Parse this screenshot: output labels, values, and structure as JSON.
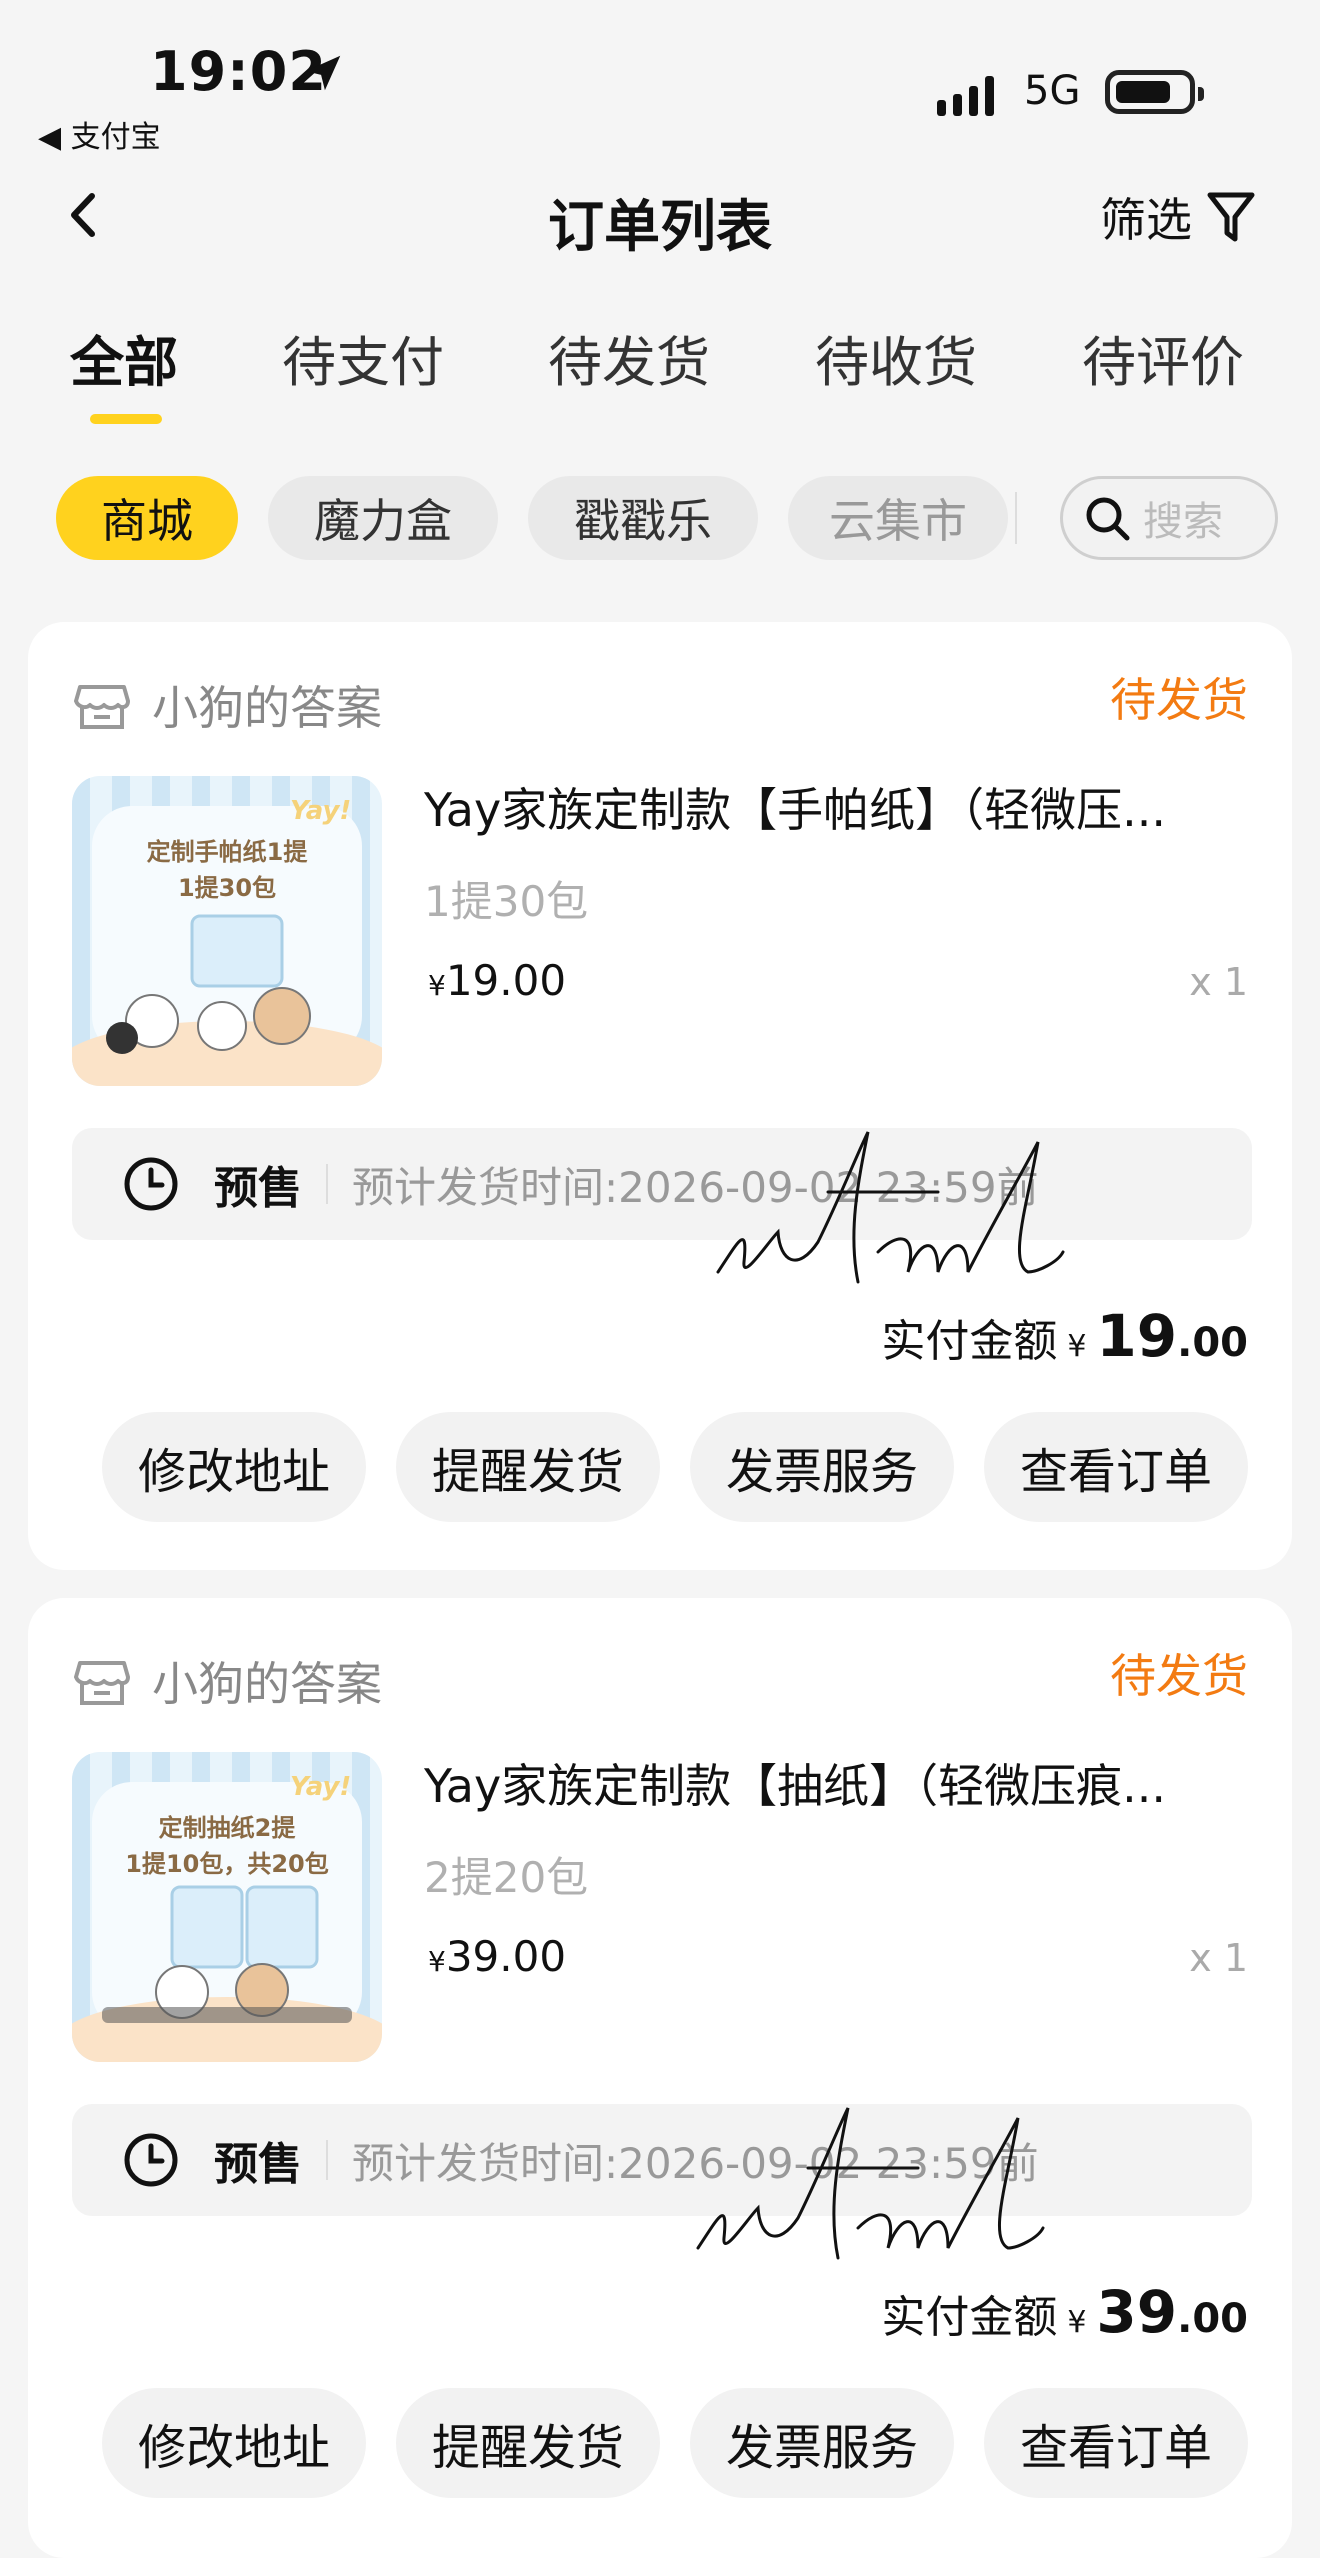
{
  "status_bar": {
    "time": "19:02",
    "back_app": "◀ 支付宝",
    "network": "5G"
  },
  "nav": {
    "title": "订单列表",
    "filter_label": "筛选"
  },
  "tabs": [
    {
      "label": "全部",
      "active": true
    },
    {
      "label": "待支付"
    },
    {
      "label": "待发货"
    },
    {
      "label": "待收货"
    },
    {
      "label": "待评价"
    }
  ],
  "chips": [
    {
      "label": "商城",
      "active": true
    },
    {
      "label": "魔力盒"
    },
    {
      "label": "戳戳乐"
    },
    {
      "label": "云集市"
    }
  ],
  "search": {
    "placeholder": "搜索"
  },
  "accent_color": "#ffd21e",
  "status_color": "#f37b12",
  "orders": [
    {
      "shop": "小狗的答案",
      "status": "待发货",
      "thumb_text": [
        "定制手帕纸1提",
        "1提30包"
      ],
      "thumb_brand": "Yay!",
      "title": "Yay家族定制款【手帕纸】（轻微压...",
      "spec": "1提30包",
      "currency": "¥",
      "price": "19.00",
      "qty": "x 1",
      "presale_label": "预售",
      "eta": "预计发货时间:2026-09-02 23:59前",
      "paid_label": "实付金额",
      "paid_int": "19",
      "paid_dec": ".00",
      "watermark": "wtml",
      "buttons": [
        "修改地址",
        "提醒发货",
        "发票服务",
        "查看订单"
      ]
    },
    {
      "shop": "小狗的答案",
      "status": "待发货",
      "thumb_text": [
        "定制抽纸2提",
        "1提10包，共20包"
      ],
      "thumb_brand": "Yay!",
      "title": "Yay家族定制款【抽纸】（轻微压痕...",
      "spec": "2提20包",
      "currency": "¥",
      "price": "39.00",
      "qty": "x 1",
      "presale_label": "预售",
      "eta": "预计发货时间:2026-09-02 23:59前",
      "paid_label": "实付金额",
      "paid_int": "39",
      "paid_dec": ".00",
      "watermark": "wtml",
      "buttons": [
        "修改地址",
        "提醒发货",
        "发票服务",
        "查看订单"
      ]
    }
  ]
}
